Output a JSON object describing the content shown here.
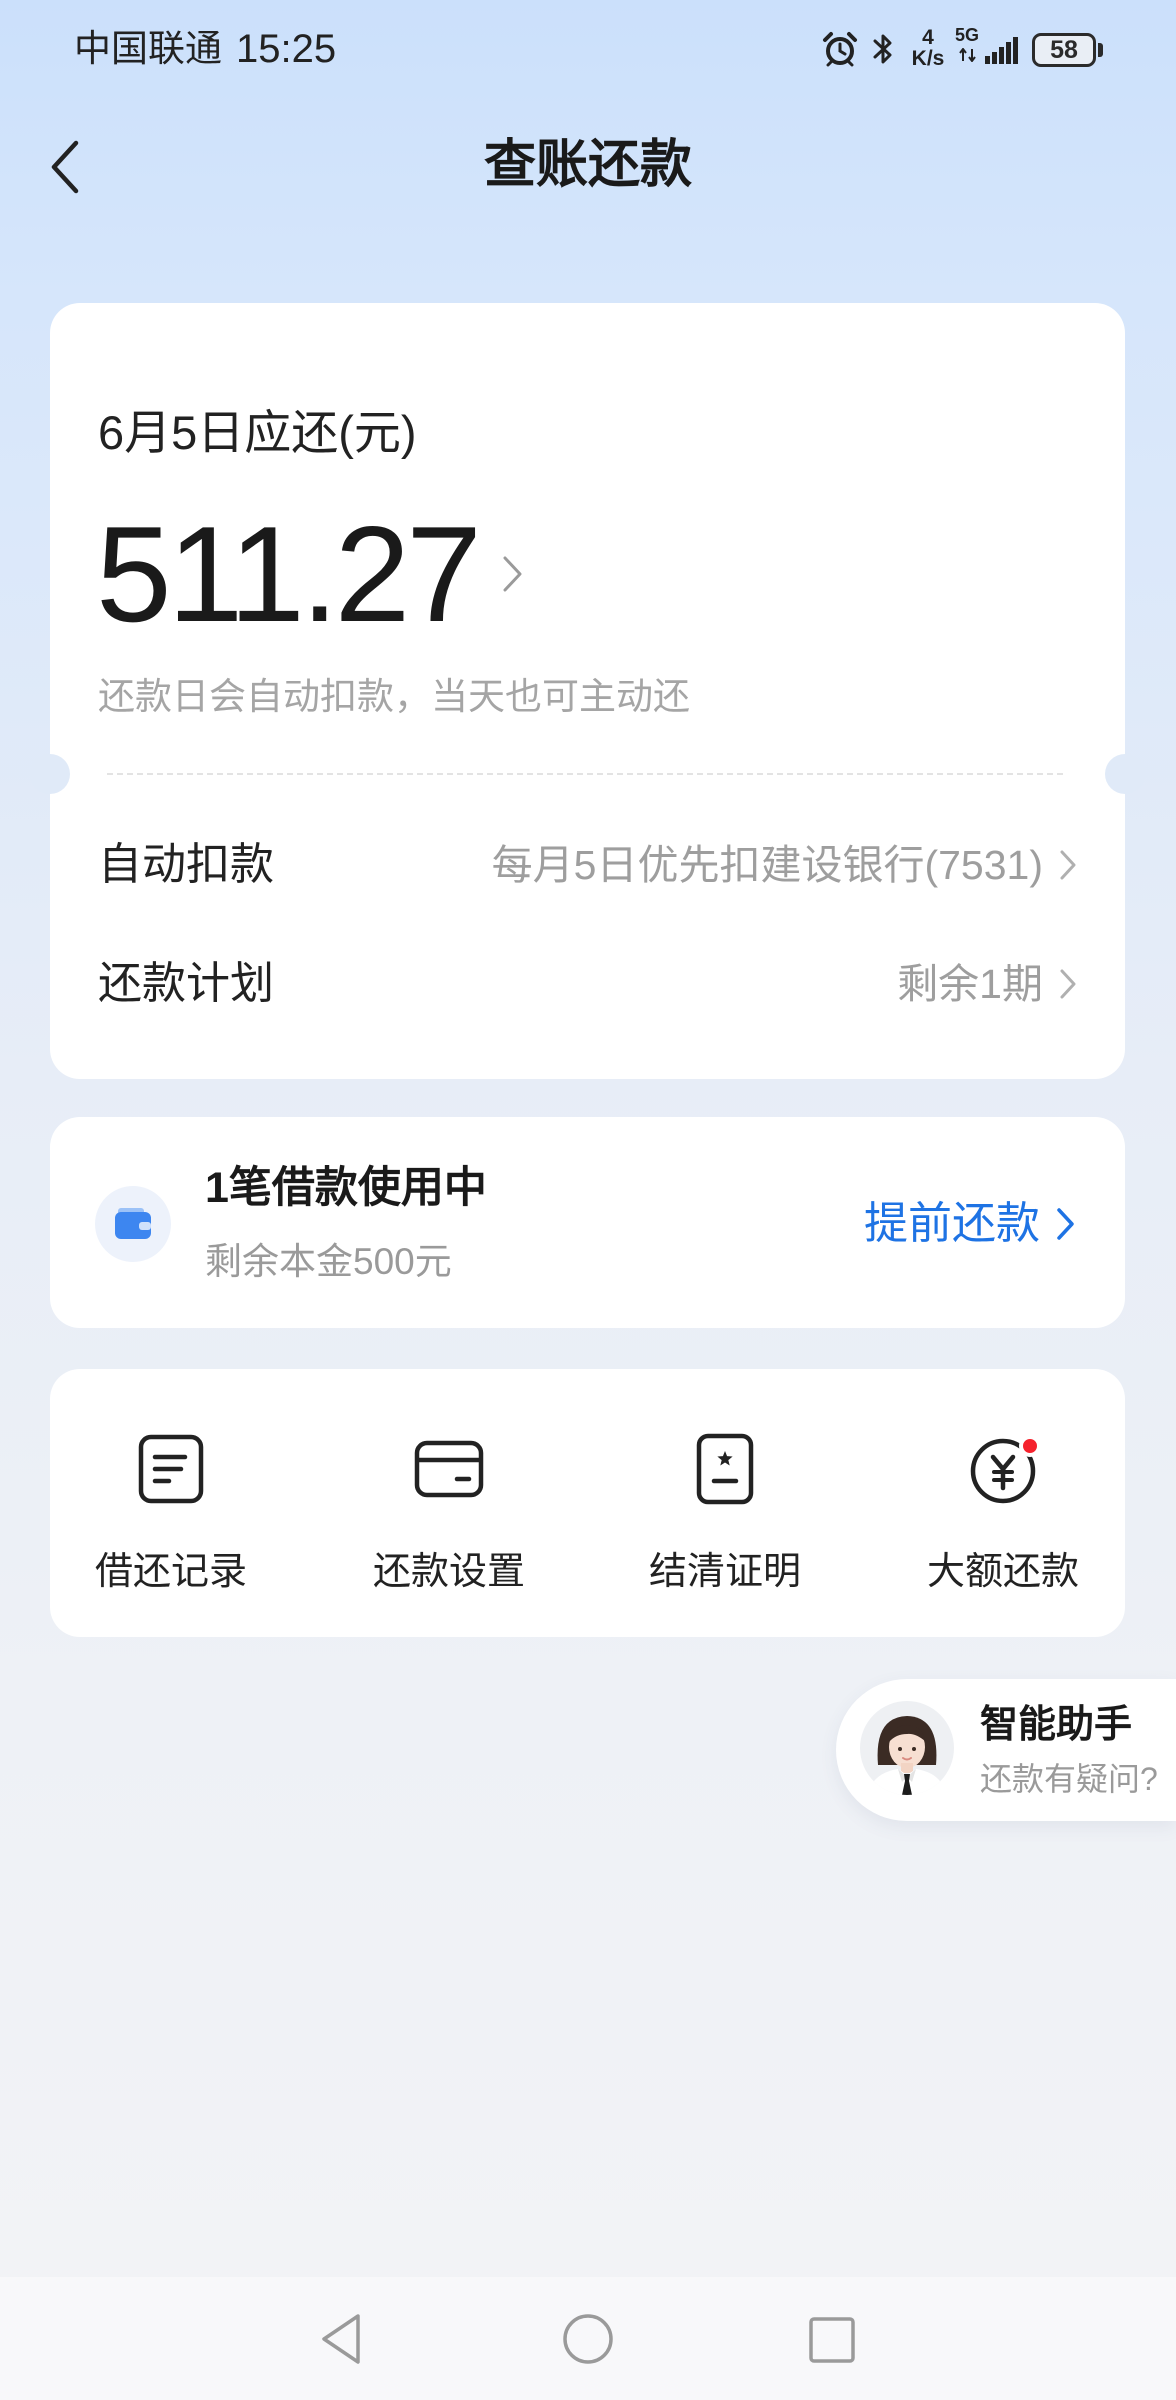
{
  "status_bar": {
    "carrier": "中国联通",
    "time": "15:25",
    "net_speed": {
      "value": "4",
      "unit": "K/s"
    },
    "network": "5G",
    "battery": "58",
    "icons": [
      "alarm-icon",
      "bluetooth-icon",
      "data-activity-icon",
      "signal-icon",
      "battery-icon"
    ]
  },
  "header": {
    "title": "查账还款",
    "back_icon": "chevron-left-icon"
  },
  "bill_card": {
    "due_label": "6月5日应还(元)",
    "amount": "511.27",
    "note": "还款日会自动扣款，当天也可主动还",
    "rows": [
      {
        "label": "自动扣款",
        "value": "每月5日优先扣建设银行(7531)"
      },
      {
        "label": "还款计划",
        "value": "剩余1期"
      }
    ]
  },
  "loan_card": {
    "icon": "wallet-icon",
    "title": "1笔借款使用中",
    "subtitle": "剩余本金500元",
    "action": "提前还款"
  },
  "shortcuts": [
    {
      "label": "借还记录",
      "icon": "document-icon",
      "has_badge": false
    },
    {
      "label": "还款设置",
      "icon": "card-icon",
      "has_badge": false
    },
    {
      "label": "结清证明",
      "icon": "certificate-icon",
      "has_badge": false
    },
    {
      "label": "大额还款",
      "icon": "yuan-circle-icon",
      "has_badge": true
    }
  ],
  "assistant": {
    "icon": "avatar-icon",
    "title": "智能助手",
    "subtitle": "还款有疑问?"
  },
  "nav_bar": {
    "icons": [
      "back-triangle-icon",
      "home-circle-icon",
      "recent-square-icon"
    ]
  },
  "colors": {
    "background_top": "#cbe0fb",
    "background_bottom": "#f2f3f6",
    "accent": "#1e73e4",
    "badge": "#f5222d",
    "wallet": "#3d86f0",
    "text_primary": "#1f1f1f",
    "text_secondary": "#9e9e9e"
  }
}
